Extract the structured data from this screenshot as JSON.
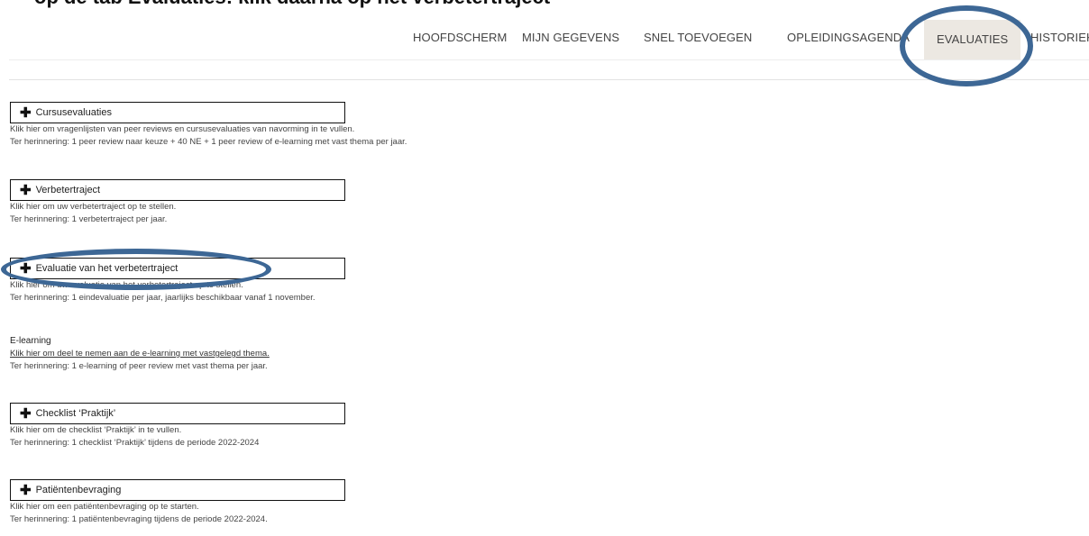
{
  "header_clipped": "op de tab Evaluaties: klik daarna op het verbetertraject",
  "nav": {
    "items": [
      {
        "label": "HOOFDSCHERM",
        "active": false
      },
      {
        "label": "MIJN GEGEVENS",
        "active": false
      },
      {
        "label": "SNEL TOEVOEGEN",
        "active": false
      },
      {
        "label": "OPLEIDINGSAGENDA",
        "active": false
      },
      {
        "label": "EVALUATIES",
        "active": true
      },
      {
        "label": "HISTORIEK",
        "active": false
      }
    ]
  },
  "sections": [
    {
      "title": "Cursusevaluaties",
      "lines": [
        "Klik hier om vragenlijsten van peer reviews en cursusevaluaties van navorming in te vullen.",
        "Ter herinnering: 1 peer review naar keuze + 40 NE + 1 peer review of e-learning met vast thema per jaar."
      ]
    },
    {
      "title": "Verbetertraject",
      "lines": [
        "Klik hier om uw verbetertraject op te stellen.",
        "Ter herinnering: 1 verbetertraject per jaar."
      ]
    },
    {
      "title": "Evaluatie van het verbetertraject",
      "lines": [
        "Klik hier om uw evaluatie van het verbetertraject op te stellen.",
        "Ter herinnering: 1 eindevaluatie per jaar, jaarlijks beschikbaar vanaf 1 november."
      ]
    },
    {
      "title": "Checklist ‘Praktijk’",
      "lines": [
        "Klik hier om de checklist ‘Praktijk’ in te vullen.",
        "Ter herinnering: 1 checklist ‘Praktijk’ tijdens de periode 2022-2024"
      ]
    },
    {
      "title": "Patiëntenbevraging",
      "lines": [
        "Klik hier om een patiëntenbevraging op te starten.",
        "Ter herinnering: 1 patiëntenbevraging tijdens de periode 2022-2024."
      ]
    }
  ],
  "elearning": {
    "heading": "E-learning",
    "link": "Klik hier om deel te nemen aan de e-learning met vastgelegd thema.",
    "note": "Ter herinnering: 1 e-learning of peer review met vast thema per jaar."
  },
  "colors": {
    "annotation_ring": "#3d6795",
    "active_tab_bg": "#ece8e2"
  }
}
